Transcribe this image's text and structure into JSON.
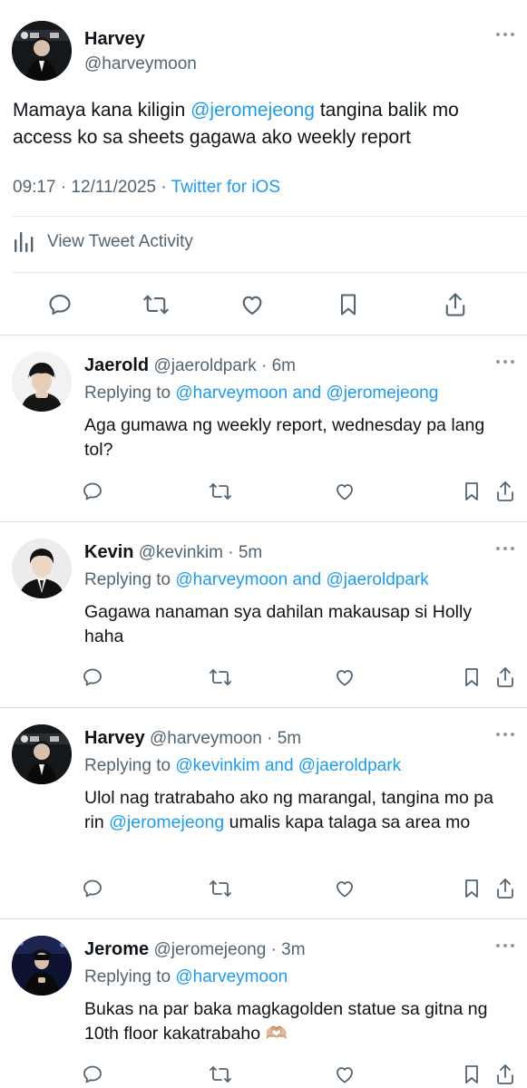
{
  "main_tweet": {
    "name": "Harvey",
    "handle": "@harveymoon",
    "text_parts": [
      "Mamaya kana kiligin ",
      "@jeromejeong",
      " tangina balik mo access ko sa sheets gagawa ako weekly report"
    ],
    "time_date": "09:17 · 12/11/2025 · ",
    "source": "Twitter for iOS",
    "activity_label": "View Tweet Activity"
  },
  "replies": [
    {
      "name": "Jaerold",
      "handle": "@jaeroldpark",
      "time": " · 6m",
      "replying_prefix": "Replying to ",
      "replying_to": "@harveymoon and @jeromejeong",
      "body_parts": [
        "Aga gumawa ng weekly report, wednesday pa lang tol?"
      ]
    },
    {
      "name": "Kevin",
      "handle": "@kevinkim",
      "time": " · 5m",
      "replying_prefix": "Replying to ",
      "replying_to": "@harveymoon and @jaeroldpark",
      "body_parts": [
        "Gagawa nanaman sya dahilan makausap si Holly haha"
      ]
    },
    {
      "name": "Harvey",
      "handle": "@harveymoon",
      "time": " · 5m",
      "replying_prefix": "Replying to ",
      "replying_to": "@kevinkim and @jaeroldpark",
      "body_parts": [
        "Ulol nag tratrabaho ako ng marangal, tangina mo pa rin ",
        "@jeromejeong",
        " umalis kapa talaga sa area mo"
      ]
    },
    {
      "name": "Jerome",
      "handle": "@jeromejeong",
      "time": " · 3m",
      "replying_prefix": "Replying to ",
      "replying_to": "@harveymoon",
      "body_parts": [
        "Bukas na par baka magkagolden statue sa gitna ng 10th floor kakatrabaho 🫶🏼"
      ]
    }
  ],
  "colors": {
    "link": "#1d9bf0",
    "secondary": "#536471",
    "divider": "#e1e8ed"
  },
  "icons": [
    "reply-icon",
    "retweet-icon",
    "like-icon",
    "bookmark-icon",
    "share-icon",
    "more-icon",
    "activity-icon"
  ]
}
